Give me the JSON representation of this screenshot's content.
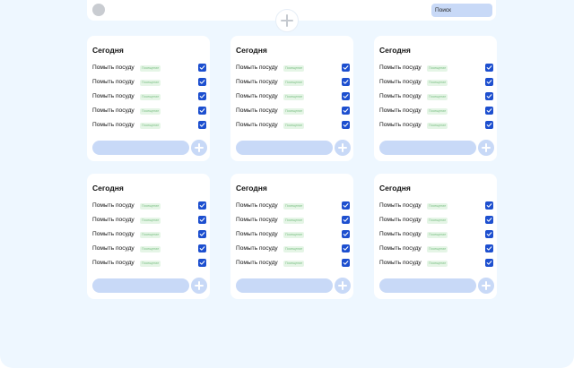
{
  "search": {
    "placeholder": "Поиск"
  },
  "colors": {
    "background": "#eef7ff",
    "accent": "#1d4fcf",
    "input": "#c8d9f7",
    "tag_bg": "#e5f5e6",
    "tag_text": "#7bbf84"
  },
  "icons": {
    "add": "plus-icon",
    "check": "check-icon",
    "avatar": "user-avatar"
  },
  "cards": [
    {
      "title": "Сегодня",
      "tasks": [
        {
          "name": "Помыть посуду",
          "tag": "Посещение",
          "checked": true
        },
        {
          "name": "Помыть посуду",
          "tag": "Посещение",
          "checked": true
        },
        {
          "name": "Помыть посуду",
          "tag": "Посещение",
          "checked": true
        },
        {
          "name": "Помыть посуду",
          "tag": "Посещение",
          "checked": true
        },
        {
          "name": "Помыть посуду",
          "tag": "Посещение",
          "checked": true
        }
      ]
    },
    {
      "title": "Сегодня",
      "tasks": [
        {
          "name": "Помыть посуду",
          "tag": "Посещение",
          "checked": true
        },
        {
          "name": "Помыть посуду",
          "tag": "Посещение",
          "checked": true
        },
        {
          "name": "Помыть посуду",
          "tag": "Посещение",
          "checked": true
        },
        {
          "name": "Помыть посуду",
          "tag": "Посещение",
          "checked": true
        },
        {
          "name": "Помыть посуду",
          "tag": "Посещение",
          "checked": true
        }
      ]
    },
    {
      "title": "Сегодня",
      "tasks": [
        {
          "name": "Помыть посуду",
          "tag": "Посещение",
          "checked": true
        },
        {
          "name": "Помыть посуду",
          "tag": "Посещение",
          "checked": true
        },
        {
          "name": "Помыть посуду",
          "tag": "Посещение",
          "checked": true
        },
        {
          "name": "Помыть посуду",
          "tag": "Посещение",
          "checked": true
        },
        {
          "name": "Помыть посуду",
          "tag": "Посещение",
          "checked": true
        }
      ]
    },
    {
      "title": "Сегодня",
      "tasks": [
        {
          "name": "Помыть посуду",
          "tag": "Посещение",
          "checked": true
        },
        {
          "name": "Помыть посуду",
          "tag": "Посещение",
          "checked": true
        },
        {
          "name": "Помыть посуду",
          "tag": "Посещение",
          "checked": true
        },
        {
          "name": "Помыть посуду",
          "tag": "Посещение",
          "checked": true
        },
        {
          "name": "Помыть посуду",
          "tag": "Посещение",
          "checked": true
        }
      ]
    },
    {
      "title": "Сегодня",
      "tasks": [
        {
          "name": "Помыть посуду",
          "tag": "Посещение",
          "checked": true
        },
        {
          "name": "Помыть посуду",
          "tag": "Посещение",
          "checked": true
        },
        {
          "name": "Помыть посуду",
          "tag": "Посещение",
          "checked": true
        },
        {
          "name": "Помыть посуду",
          "tag": "Посещение",
          "checked": true
        },
        {
          "name": "Помыть посуду",
          "tag": "Посещение",
          "checked": true
        }
      ]
    },
    {
      "title": "Сегодня",
      "tasks": [
        {
          "name": "Помыть посуду",
          "tag": "Посещение",
          "checked": true
        },
        {
          "name": "Помыть посуду",
          "tag": "Посещение",
          "checked": true
        },
        {
          "name": "Помыть посуду",
          "tag": "Посещение",
          "checked": true
        },
        {
          "name": "Помыть посуду",
          "tag": "Посещение",
          "checked": true
        },
        {
          "name": "Помыть посуду",
          "tag": "Посещение",
          "checked": true
        }
      ]
    }
  ]
}
